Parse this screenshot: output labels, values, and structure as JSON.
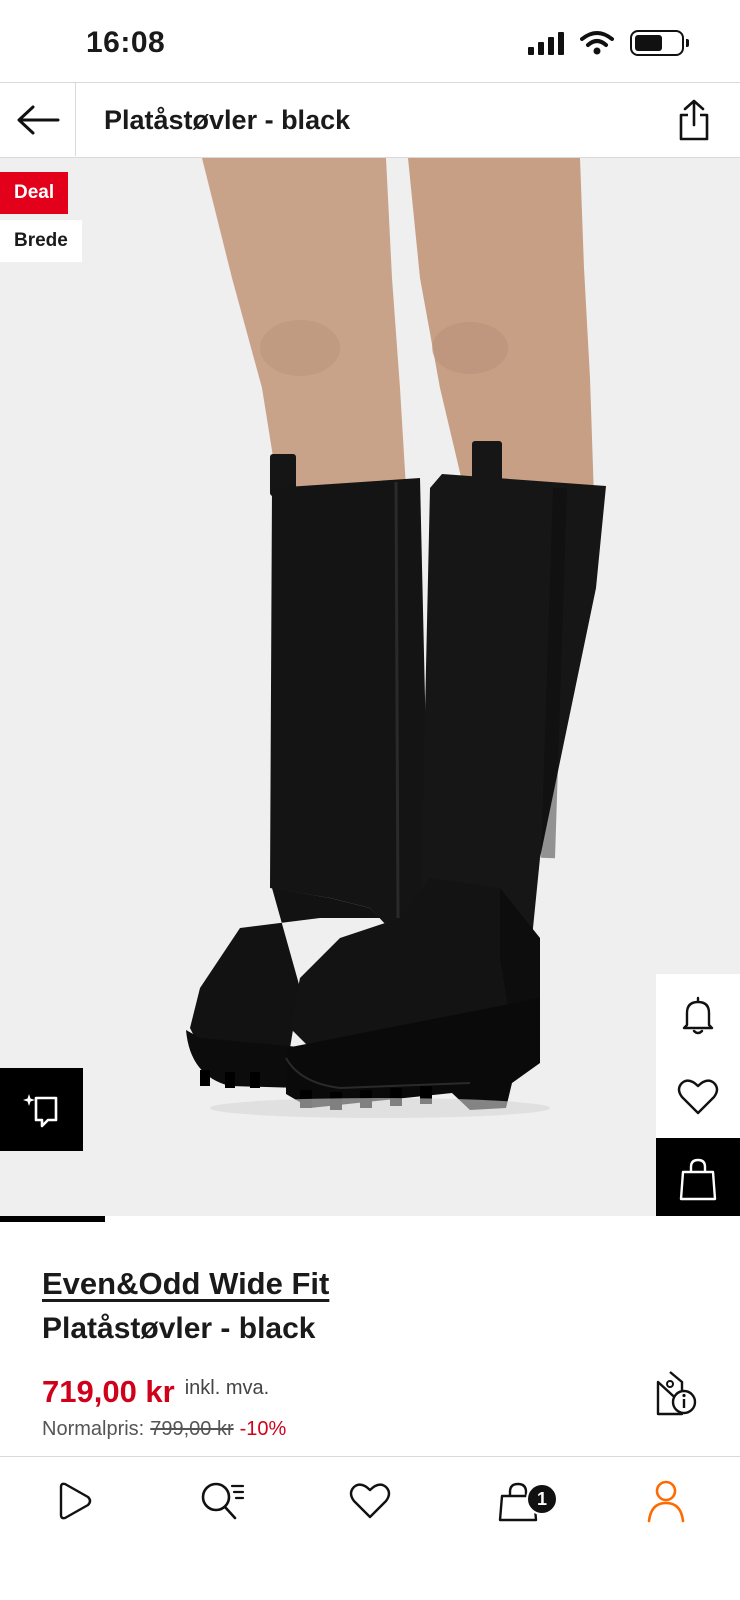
{
  "status_bar": {
    "time": "16:08"
  },
  "header": {
    "title": "Platåstøvler - black"
  },
  "gallery": {
    "flags": {
      "deal": "Deal",
      "brede": "Brede"
    },
    "progress_fraction": 0.17
  },
  "product": {
    "brand": "Even&Odd Wide Fit",
    "name": "Platåstøvler - black",
    "price": "719,00 kr",
    "vat_label": "inkl. mva.",
    "normal_label": "Normalpris:",
    "old_price": "799,00 kr",
    "discount": "-10%"
  },
  "bottom_nav": {
    "items": [
      {
        "icon": "play-icon"
      },
      {
        "icon": "search-list-icon"
      },
      {
        "icon": "heart-icon"
      },
      {
        "icon": "bag-icon",
        "badge": "1"
      },
      {
        "icon": "profile-icon",
        "active": true
      }
    ]
  },
  "colors": {
    "accent": "#e3001b",
    "price": "#d0021b",
    "active_nav": "#ff6900"
  }
}
